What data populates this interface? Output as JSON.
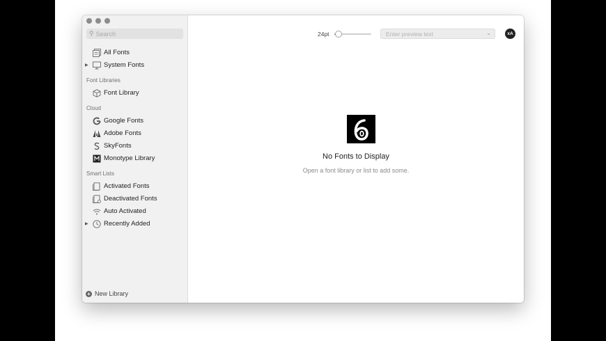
{
  "search": {
    "placeholder": "Search"
  },
  "sidebar": {
    "top_items": [
      {
        "label": "All Fonts",
        "icon": "stack-icon"
      },
      {
        "label": "System Fonts",
        "icon": "monitor-icon"
      }
    ],
    "sections": {
      "font_libraries": "Font Libraries",
      "cloud": "Cloud",
      "smart_lists": "Smart Lists"
    },
    "library_items": [
      {
        "label": "Font Library",
        "icon": "cube-icon"
      }
    ],
    "cloud_items": [
      {
        "label": "Google Fonts",
        "icon": "google-icon"
      },
      {
        "label": "Adobe Fonts",
        "icon": "adobe-icon"
      },
      {
        "label": "SkyFonts",
        "icon": "skyfonts-icon"
      },
      {
        "label": "Monotype Library",
        "icon": "monotype-icon"
      }
    ],
    "smart_items": [
      {
        "label": "Activated Fonts",
        "icon": "activated-icon"
      },
      {
        "label": "Deactivated Fonts",
        "icon": "deactivated-icon"
      },
      {
        "label": "Auto Activated",
        "icon": "wifi-icon"
      },
      {
        "label": "Recently Added",
        "icon": "clock-icon"
      }
    ],
    "new_library": "New Library"
  },
  "toolbar": {
    "font_size": "24pt",
    "slider_fraction": 0.12,
    "preview_placeholder": "Enter preview text",
    "avatar_text": "xA"
  },
  "empty_state": {
    "title": "No Fonts to Display",
    "subtitle": "Open a font library or list to add some."
  }
}
